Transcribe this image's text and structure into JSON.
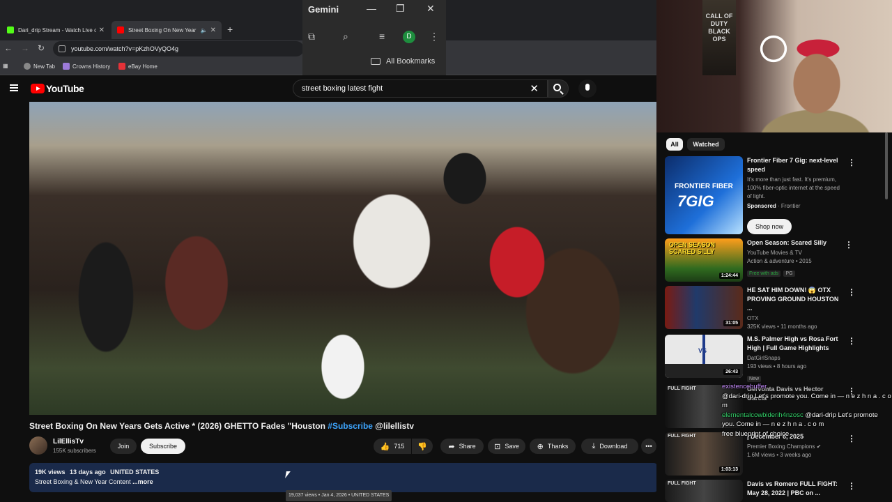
{
  "browser": {
    "tabs": [
      {
        "title": "Dari_drip Stream - Watch Live o",
        "active": false
      },
      {
        "title": "Street Boxing On New Year",
        "active": true
      }
    ],
    "url": "youtube.com/watch?v=pKzhOVyQO4g",
    "bookmarks": [
      "New Tab",
      "Crowns History",
      "eBay Home"
    ]
  },
  "gemini": {
    "title": "Gemini",
    "avatar_letter": "D",
    "all_bookmarks": "All Bookmarks"
  },
  "youtube": {
    "logo": "YouTube",
    "search_value": "street boxing  latest fight"
  },
  "video": {
    "title_main": "Street Boxing On New Years Gets Active * (2026) GHETTO Fades \"Houston ",
    "title_tag": "#Subscribe",
    "title_end": " @lilellistv",
    "channel": "LilEllisTv",
    "subscribers": "155K subscribers",
    "join_label": "Join",
    "subscribe_label": "Subscribe",
    "likes": "715",
    "share_label": "Share",
    "save_label": "Save",
    "thanks_label": "Thanks",
    "download_label": "Download",
    "views": "19K views",
    "age": "13 days ago",
    "country": "UNITED STATES",
    "description": "Street Boxing & New Year Content",
    "more_label": "...more",
    "tooltip": "19,037 views • Jan 4, 2026 • UNITED STATES"
  },
  "webcam": {
    "poster_text": "CALL OF DUTY BLACK OPS"
  },
  "sidebar": {
    "chips": [
      "All",
      "Watched"
    ],
    "items": [
      {
        "title": "Frontier Fiber 7 Gig: next-level speed",
        "desc": "It's more than just fast. It's premium, 100% fiber-optic internet at the speed of light.",
        "sponsored": "Sponsored",
        "advertiser": "Frontier",
        "cta": "Shop now",
        "thumb_text_1": "FRONTIER FIBER",
        "thumb_text_2": "7GIG"
      },
      {
        "title": "Open Season: Scared Silly",
        "channel": "YouTube Movies & TV",
        "meta": "Action & adventure • 2015",
        "badge1": "Free with ads",
        "badge2": "PG",
        "duration": "1:24:44",
        "thumb_text": "OPEN SEASON SCARED SILLY"
      },
      {
        "title": "HE SAT HIM DOWN! 😱 OTX PROVING GROUND HOUSTON ...",
        "channel": "OTX",
        "meta": "325K views • 11 months ago",
        "duration": "31:05"
      },
      {
        "title": "M.S. Palmer High vs Rosa Fort High | Full Game Highlights",
        "channel": "DatGirlSnaps",
        "meta": "193 views • 8 hours ago",
        "badge": "New",
        "duration": "26:43",
        "thumb_text": "VS"
      },
      {
        "title": "Gervonta Davis vs Hector Garcia",
        "duration": "",
        "thumb_text": "FULL FIGHT"
      },
      {
        "title": "Gervonta Davis vs Rolly Romero Fight Night | December 6, 2025",
        "title_visible": "| December 6, 2025",
        "channel": "Premier Boxing Champions",
        "meta": "1.6M views • 3 weeks ago",
        "duration": "1:03:13",
        "thumb_text": "FULL FIGHT"
      },
      {
        "title": "Davis vs Romero FULL FIGHT: May 28, 2022 | PBC on ...",
        "thumb_text": "FULL FIGHT"
      }
    ]
  },
  "chat": [
    {
      "user": "existencebuffer",
      "text": ""
    },
    {
      "user": "",
      "text": "@dari-drip Let's promote you. Come in — n e z h n a . c o m"
    },
    {
      "user": "elementalcowbiderih4nzosc",
      "text": "@dari-drip Let's promote you. Come in — n e z h n a . c o m"
    },
    {
      "user": "",
      "text": "free blueprint of choice"
    }
  ]
}
